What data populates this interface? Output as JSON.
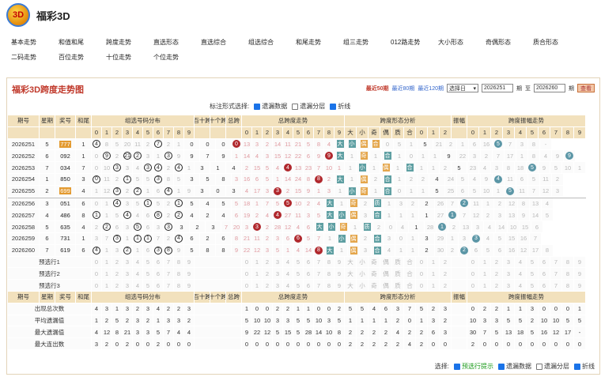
{
  "app": {
    "title": "福彩3D",
    "logo_text": "3D"
  },
  "nav": [
    [
      "基本走势",
      "和值和尾",
      "跨度走势",
      "直选形态",
      "直选综合",
      "组选综合",
      "和尾走势",
      "组三走势",
      "012路走势",
      "大小形态",
      "奇偶形态",
      "质合形态"
    ],
    [
      "二码走势",
      "百位走势",
      "十位走势",
      "个位走势"
    ]
  ],
  "panel": {
    "title": "福彩3D跨度走势图",
    "links": [
      "最近50期",
      "最近80期",
      "最近120期"
    ],
    "select": "选择日",
    "from": "2026251",
    "to_label": "至",
    "to": "2026260",
    "period": "期",
    "query": "查看"
  },
  "opt1": {
    "label": "标注形式选择:",
    "items": [
      {
        "t": "遗漏数据",
        "on": true
      },
      {
        "t": "遗漏分层",
        "on": false
      },
      {
        "t": "折线",
        "on": true
      }
    ]
  },
  "headers": {
    "r1": [
      "期号",
      "星期",
      "奖号",
      "和尾",
      "组选号码分布",
      "百十跨",
      "十个跨",
      "总跨",
      "总跨度走势",
      "跨度形态分析",
      "振幅",
      "跨度振幅走势"
    ],
    "digits": [
      "0",
      "1",
      "2",
      "3",
      "4",
      "5",
      "6",
      "7",
      "8",
      "9"
    ],
    "form": [
      "大",
      "小",
      "奇",
      "偶",
      "质",
      "合",
      "0",
      "1",
      "2"
    ]
  },
  "rows": [
    [
      "2026251",
      "5",
      "777",
      "1",
      "4 8 5 20 11 2 7 2 1",
      "0",
      "0",
      "0",
      "0 13 3 2 14 11 21 5 8 4",
      "大 小 偶 合 0 5 1",
      "5",
      "21 2 1 6 16 5 7 3 8 -"
    ],
    [
      "2026252",
      "6",
      "092",
      "1",
      "0 9 2 21 2 3 1 3 9",
      "9",
      "7",
      "9",
      "1 14 4 3 15 12 22 6 9 9",
      "大 1 奇 1 合 1 0 1 1",
      "9",
      "22 3 2 7 17 1 8 4 9 9"
    ],
    [
      "2026253",
      "7",
      "034",
      "7",
      "0 10 3 3 4 3 4 2 4 1",
      "3",
      "1",
      "4",
      "2 15 5 4 4 13 23 7 10 1",
      "1 小 1 偶 1 合 1 1 2",
      "5",
      "23 4 3 8 18 5 9 5 10 1"
    ],
    [
      "2026254",
      "1",
      "850",
      "3",
      "0 11 2 1 5 5 3 8 5",
      "3",
      "5",
      "8",
      "3 16 6 5 1 14 24 8 8 2",
      "大 1 偶 2 合 1 2 2",
      "4",
      "24 5 4 9 4 11 6 5 11 2"
    ],
    [
      "2026255",
      "2",
      "699",
      "4",
      "1 12 3 2 2 1 6 4 1 9",
      "3",
      "0",
      "3",
      "4 17 3 6 2 15 9 1 3",
      "1 小 奇 1 合 0 1 1",
      "5",
      "25 6 5 10 1 5 11 7 12 3"
    ],
    [
      "2026256",
      "3",
      "051",
      "6",
      "0 1 4 3 5 1 5 2 1",
      "5",
      "4",
      "5",
      "5 18 1 7 5 26 10 2 4",
      "大 1 奇 2 质 1 3 2",
      "2",
      "26 7 2 11 1 2 12 8 13 4"
    ],
    [
      "2026257",
      "4",
      "486",
      "8",
      "1 1 5 4 4 6 8 2 2",
      "4",
      "2",
      "4",
      "6 19 2 4 1 27 11 3 5",
      "大 小 偶 3 合 1 1 1",
      "1",
      "27 1 7 12 2 3 13 9 14 5"
    ],
    [
      "2026258",
      "5",
      "635",
      "4",
      "2 2 6 3 5 6 3 3",
      "3",
      "2",
      "3",
      "7 20 3 1 2 28 12 4 6",
      "大 小 奇 1 质 2 0 4",
      "1",
      "28 1 2 13 3 4 14 10 15 6"
    ],
    [
      "2026259",
      "6",
      "731",
      "1",
      "3 7 3 1 1 1 7 2 4",
      "6",
      "2",
      "6",
      "8 21 11 2 3 6 13 5 7",
      "1 小 偶 2 合 3 0 1",
      "3",
      "29 1 3 5 4 5 15 16 7"
    ],
    [
      "2026260",
      "7",
      "619",
      "6",
      "4 1 3 2 1 6 3 8 9",
      "5",
      "8",
      "8",
      "9 22 12 3 5 1 4 14 8",
      "大 1 偶 3 合 4 1 1",
      "2",
      "30 2 1 6 5 6 16 12 17 8"
    ]
  ],
  "pick": [
    "预选行1",
    "预选行2",
    "预选行3"
  ],
  "footer_headers": [
    "期号",
    "星期",
    "奖号",
    "和尾",
    "组选号码分布",
    "百十跨",
    "十个跨",
    "总跨",
    "总跨度走势",
    "跨度形态分析",
    "振幅",
    "跨度振幅走势"
  ],
  "stats": [
    [
      "出现总次数",
      "4 3 1 3 2 3 4 2 2 3",
      "1 0 0 2 2 1 1 0 0 2 1",
      "5 5 4 6 3 7 5 2 3",
      "0 2 2 1 1 3 0 0 0 1"
    ],
    [
      "平均遗漏值",
      "1 2 5 2 3 2 1 3 3 2",
      "5 10 10 3 3 5 5 10 3 5",
      "1 1 1 1 2 0 1 3 2",
      "10 3 3 5 5 2 10 10 5 5"
    ],
    [
      "最大遗漏值",
      "4 12 8 21 3 3 5 7 4 4",
      "9 22 12 5 15 5 28 14 10 8",
      "2 2 2 2 4 2 2 6 3",
      "30 7 5 13 18 5 16 12 17 -"
    ],
    [
      "最大连出数",
      "3 2 0 2 0 0 2 0 0 0",
      "0 0 0 0 0 0 0 0 0 0",
      "2 2 2 2 2 4 2 0 0",
      "2 0 0 0 0 0 0 0 0 0"
    ]
  ],
  "opt2": {
    "label": "选择:",
    "items": [
      {
        "t": "预选行提示",
        "on": true,
        "green": true
      },
      {
        "t": "遗漏数据",
        "on": true
      },
      {
        "t": "遗漏分层",
        "on": false
      },
      {
        "t": "折线",
        "on": true
      }
    ]
  }
}
